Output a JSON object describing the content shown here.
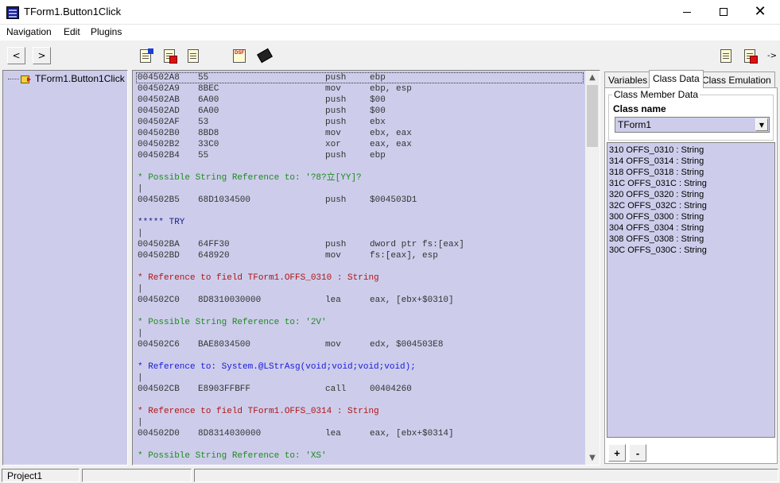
{
  "window": {
    "title": "TForm1.Button1Click"
  },
  "menu": [
    "Navigation",
    "Edit",
    "Plugins"
  ],
  "tree": {
    "node_label": "TForm1.Button1Click"
  },
  "code": [
    {
      "kind": "ins",
      "addr": "004502A8",
      "hex": "55",
      "mn": "push",
      "op": "ebp",
      "sel": true
    },
    {
      "kind": "ins",
      "addr": "004502A9",
      "hex": "8BEC",
      "mn": "mov",
      "op": "ebp, esp"
    },
    {
      "kind": "ins",
      "addr": "004502AB",
      "hex": "6A00",
      "mn": "push",
      "op": "$00"
    },
    {
      "kind": "ins",
      "addr": "004502AD",
      "hex": "6A00",
      "mn": "push",
      "op": "$00"
    },
    {
      "kind": "ins",
      "addr": "004502AF",
      "hex": "53",
      "mn": "push",
      "op": "ebx"
    },
    {
      "kind": "ins",
      "addr": "004502B0",
      "hex": "8BD8",
      "mn": "mov",
      "op": "ebx, eax"
    },
    {
      "kind": "ins",
      "addr": "004502B2",
      "hex": "33C0",
      "mn": "xor",
      "op": "eax, eax"
    },
    {
      "kind": "ins",
      "addr": "004502B4",
      "hex": "55",
      "mn": "push",
      "op": "ebp"
    },
    {
      "kind": "blank"
    },
    {
      "kind": "comment",
      "color": "green",
      "text": "* Possible String Reference to: '?8?立[YY]?"
    },
    {
      "kind": "bar",
      "text": "|"
    },
    {
      "kind": "ins",
      "addr": "004502B5",
      "hex": "68D1034500",
      "mn": "push",
      "op": "$004503D1"
    },
    {
      "kind": "blank"
    },
    {
      "kind": "comment",
      "color": "navy",
      "text": "***** TRY"
    },
    {
      "kind": "bar",
      "text": "|"
    },
    {
      "kind": "ins",
      "addr": "004502BA",
      "hex": "64FF30",
      "mn": "push",
      "op": "dword ptr fs:[eax]"
    },
    {
      "kind": "ins",
      "addr": "004502BD",
      "hex": "648920",
      "mn": "mov",
      "op": "fs:[eax], esp"
    },
    {
      "kind": "blank"
    },
    {
      "kind": "comment",
      "color": "red",
      "text": "* Reference to field TForm1.OFFS_0310 : String"
    },
    {
      "kind": "bar",
      "text": "|"
    },
    {
      "kind": "ins",
      "addr": "004502C0",
      "hex": "8D8310030000",
      "mn": "lea",
      "op": "eax, [ebx+$0310]"
    },
    {
      "kind": "blank"
    },
    {
      "kind": "comment",
      "color": "green",
      "text": "* Possible String Reference to: '2V'"
    },
    {
      "kind": "bar",
      "text": "|"
    },
    {
      "kind": "ins",
      "addr": "004502C6",
      "hex": "BAE8034500",
      "mn": "mov",
      "op": "edx, $004503E8"
    },
    {
      "kind": "blank"
    },
    {
      "kind": "comment",
      "color": "blue",
      "text": "* Reference to: System.@LStrAsg(void;void;void;void);"
    },
    {
      "kind": "bar",
      "text": "|"
    },
    {
      "kind": "ins",
      "addr": "004502CB",
      "hex": "E8903FFBFF",
      "mn": "call",
      "op": "00404260"
    },
    {
      "kind": "blank"
    },
    {
      "kind": "comment",
      "color": "red",
      "text": "* Reference to field TForm1.OFFS_0314 : String"
    },
    {
      "kind": "bar",
      "text": "|"
    },
    {
      "kind": "ins",
      "addr": "004502D0",
      "hex": "8D8314030000",
      "mn": "lea",
      "op": "eax, [ebx+$0314]"
    },
    {
      "kind": "blank"
    },
    {
      "kind": "comment",
      "color": "green",
      "text": "* Possible String Reference to: 'XS'"
    }
  ],
  "right": {
    "tabs": [
      "Variables",
      "Class Data",
      "Class Emulation"
    ],
    "active_tab": 1,
    "group_title": "Class Member Data",
    "class_name_label": "Class name",
    "class_name_value": "TForm1",
    "members": [
      "310  OFFS_0310 : String",
      "314  OFFS_0314 : String",
      "318  OFFS_0318 : String",
      "31C  OFFS_031C : String",
      "320  OFFS_0320 : String",
      "32C  OFFS_032C : String",
      "300  OFFS_0300 : String",
      "304  OFFS_0304 : String",
      "308  OFFS_0308 : String",
      "30C  OFFS_030C : String"
    ],
    "add_label": "+",
    "remove_label": "-"
  },
  "toolbar": {
    "back": "<",
    "forward": ">",
    "more": "->"
  },
  "status": {
    "project": "Project1"
  },
  "colors": {
    "pane": "#cdcdeb",
    "green": "#1f8a1f",
    "red": "#b01515",
    "blue": "#1a1adc"
  }
}
